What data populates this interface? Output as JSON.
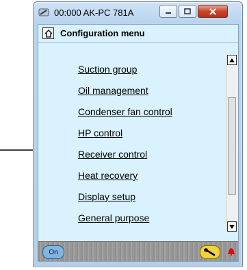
{
  "window": {
    "title": "00:000 AK-PC 781A",
    "icon": "device-icon",
    "buttons": [
      "minimize-icon",
      "maximize-icon",
      "close-icon"
    ]
  },
  "menu": {
    "title": "Configuration menu",
    "home_icon": "home-icon",
    "items": [
      {
        "label": "Suction group"
      },
      {
        "label": "Oil management"
      },
      {
        "label": "Condenser fan control"
      },
      {
        "label": "HP control"
      },
      {
        "label": "Receiver control"
      },
      {
        "label": "Heat recovery"
      },
      {
        "label": "Display setup"
      },
      {
        "label": "General purpose"
      }
    ]
  },
  "status": {
    "left_text": "On",
    "wrench_icon": "wrench-icon",
    "alarm_icon": "bell-icon"
  },
  "colors": {
    "client_bg": "#d9f2fd",
    "status_bg": "#999999",
    "close_button": "#c7442b",
    "alarm": "#e30613",
    "wrench_badge": "#f2d23a"
  },
  "annotation": {
    "arrow_icon": "arrow-right-icon"
  }
}
